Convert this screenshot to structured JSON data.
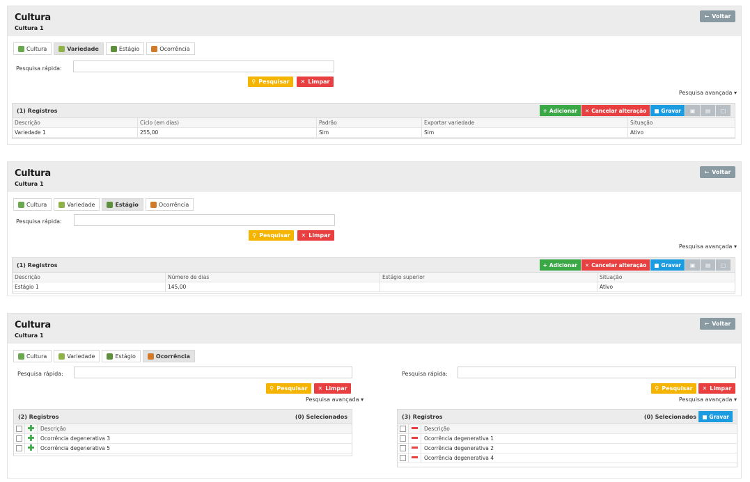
{
  "app": {
    "title": "Cultura",
    "subtitle": "Cultura 1",
    "back_label": "Voltar"
  },
  "tabs": [
    "Cultura",
    "Variedade",
    "Estágio",
    "Ocorrência"
  ],
  "search": {
    "label": "Pesquisa rápida:",
    "value": "",
    "search_btn": "Pesquisar",
    "clear_btn": "Limpar",
    "advanced": "Pesquisa avançada"
  },
  "toolbar": {
    "add": "Adicionar",
    "cancel": "Cancelar alteração",
    "save": "Gravar"
  },
  "panel1": {
    "active_tab": "Variedade",
    "records": "(1) Registros",
    "columns": [
      "Descrição",
      "Ciclo (em dias)",
      "Padrão",
      "Exportar variedade",
      "Situação"
    ],
    "rows": [
      [
        "Variedade 1",
        "255,00",
        "Sim",
        "Sim",
        "Ativo"
      ]
    ]
  },
  "panel2": {
    "active_tab": "Estágio",
    "records": "(1) Registros",
    "columns": [
      "Descrição",
      "Número de dias",
      "Estágio superior",
      "Situação"
    ],
    "rows": [
      [
        "Estágio 1",
        "145,00",
        "",
        "Ativo"
      ]
    ]
  },
  "panel3": {
    "active_tab": "Ocorrência",
    "left": {
      "records": "(2) Registros",
      "selected": "(0) Selecionados",
      "column": "Descrição",
      "rows": [
        "Ocorrência degenerativa 3",
        "Ocorrência degenerativa 5"
      ]
    },
    "right": {
      "records": "(3) Registros",
      "selected": "(0) Selecionados",
      "column": "Descrição",
      "rows": [
        "Ocorrência degenerativa 1",
        "Ocorrência degenerativa 2",
        "Ocorrência degenerativa 4"
      ]
    }
  },
  "colors": {
    "yellow": "#f5b400",
    "red": "#e84040",
    "green": "#3aa845",
    "blue": "#1b9be0",
    "back": "#8a9aa3"
  }
}
